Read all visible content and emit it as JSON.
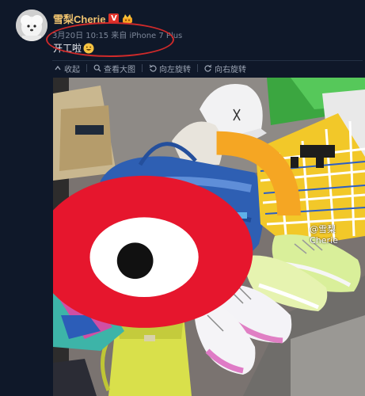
{
  "post": {
    "author": "雪梨Cherie",
    "verified_badge": "V",
    "meta": "3月20日 10:15 来自 iPhone 7 Plus",
    "text": "开工啦",
    "emoji_icon": "grinning-face-icon"
  },
  "actions": [
    {
      "label": "收起",
      "icon": "collapse-icon"
    },
    {
      "label": "查看大图",
      "icon": "magnify-icon"
    },
    {
      "label": "向左旋转",
      "icon": "rotate-left-icon"
    },
    {
      "label": "向右旋转",
      "icon": "rotate-right-icon"
    }
  ],
  "watermark": {
    "text": "@雪梨Cherie",
    "logo": "weibo-logo"
  },
  "colors": {
    "background": "#0f1829",
    "author_name": "#f1c470",
    "meta_text": "#7d8799",
    "highlight_ellipse": "#cf2a2a",
    "verified_badge": "#e0322a"
  }
}
